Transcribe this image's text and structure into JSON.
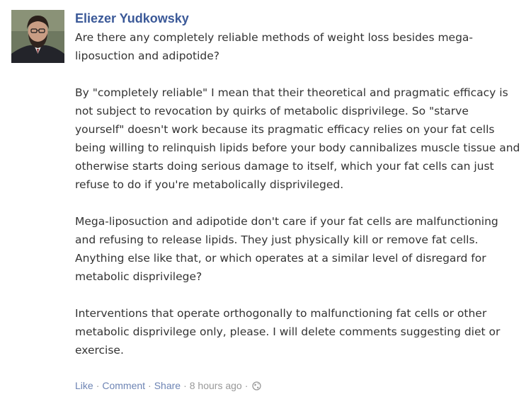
{
  "post": {
    "author": "Eliezer Yudkowsky",
    "paragraphs": [
      "Are there any completely reliable methods of weight loss besides mega-liposuction and adipotide?",
      "By \"completely reliable\" I mean that their theoretical and pragmatic efficacy is not subject to revocation by quirks of metabolic disprivilege. So \"starve yourself\" doesn't work because its pragmatic efficacy relies on your fat cells being willing to relinquish lipids before your body cannibalizes muscle tissue and otherwise starts doing serious damage to itself, which your fat cells can just refuse to do if you're metabolically disprivileged.",
      "Mega-liposuction and adipotide don't care if your fat cells are malfunctioning and refusing to release lipids. They just physically kill or remove fat cells. Anything else like that, or which operates at a similar level of disregard for metabolic disprivilege?",
      "Interventions that operate orthogonally to malfunctioning fat cells or other metabolic disprivilege only, please. I will delete comments suggesting diet or exercise."
    ]
  },
  "actions": {
    "like": "Like",
    "comment": "Comment",
    "share": "Share",
    "timestamp": "8 hours ago",
    "separator": "·",
    "privacy_icon": "globe-icon"
  },
  "colors": {
    "author_link": "#3b5998",
    "action_link": "#6d84b4",
    "meta_text": "#999999",
    "body_text": "#333333"
  }
}
